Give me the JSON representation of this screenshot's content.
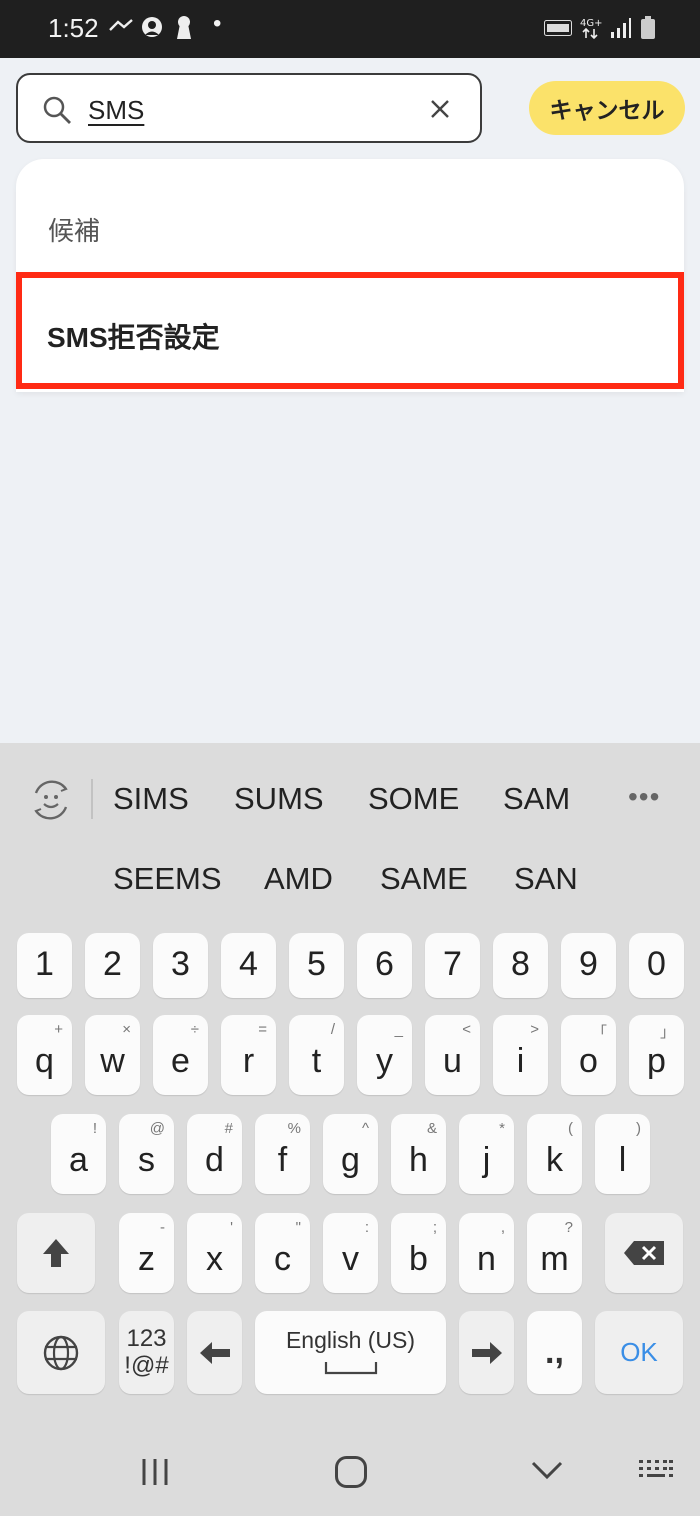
{
  "status_bar": {
    "time": "1:52"
  },
  "search": {
    "value": "SMS",
    "cancel_label": "キャンセル"
  },
  "suggestions": {
    "header": "候補",
    "items": [
      {
        "label": "SMS拒否設定"
      }
    ]
  },
  "keyboard": {
    "predictions_row1": [
      "SIMS",
      "SUMS",
      "SOME",
      "SAM"
    ],
    "predictions_row2": [
      "SEEMS",
      "AMD",
      "SAME",
      "SAN"
    ],
    "number_row": [
      "1",
      "2",
      "3",
      "4",
      "5",
      "6",
      "7",
      "8",
      "9",
      "0"
    ],
    "row1": [
      {
        "key": "q",
        "hint": "+"
      },
      {
        "key": "w",
        "hint": "×"
      },
      {
        "key": "e",
        "hint": "÷"
      },
      {
        "key": "r",
        "hint": "="
      },
      {
        "key": "t",
        "hint": "/"
      },
      {
        "key": "y",
        "hint": "_"
      },
      {
        "key": "u",
        "hint": "<"
      },
      {
        "key": "i",
        "hint": ">"
      },
      {
        "key": "o",
        "hint": "「"
      },
      {
        "key": "p",
        "hint": "」"
      }
    ],
    "row2": [
      {
        "key": "a",
        "hint": "!"
      },
      {
        "key": "s",
        "hint": "@"
      },
      {
        "key": "d",
        "hint": "#"
      },
      {
        "key": "f",
        "hint": "%"
      },
      {
        "key": "g",
        "hint": "^"
      },
      {
        "key": "h",
        "hint": "&"
      },
      {
        "key": "j",
        "hint": "*"
      },
      {
        "key": "k",
        "hint": "("
      },
      {
        "key": "l",
        "hint": ")"
      }
    ],
    "row3": [
      {
        "key": "z",
        "hint": "-"
      },
      {
        "key": "x",
        "hint": "'"
      },
      {
        "key": "c",
        "hint": "\""
      },
      {
        "key": "v",
        "hint": ":"
      },
      {
        "key": "b",
        "hint": ";"
      },
      {
        "key": "n",
        "hint": ","
      },
      {
        "key": "m",
        "hint": "?"
      }
    ],
    "symbols_key": {
      "line1": "123",
      "line2": "!@#"
    },
    "space_label": "English (US)",
    "punct_label": ".,",
    "ok_label": "OK"
  },
  "colors": {
    "highlight": "#ff2a14",
    "cancel_bg": "#fbe26a",
    "ok_text": "#3a8ee6"
  }
}
